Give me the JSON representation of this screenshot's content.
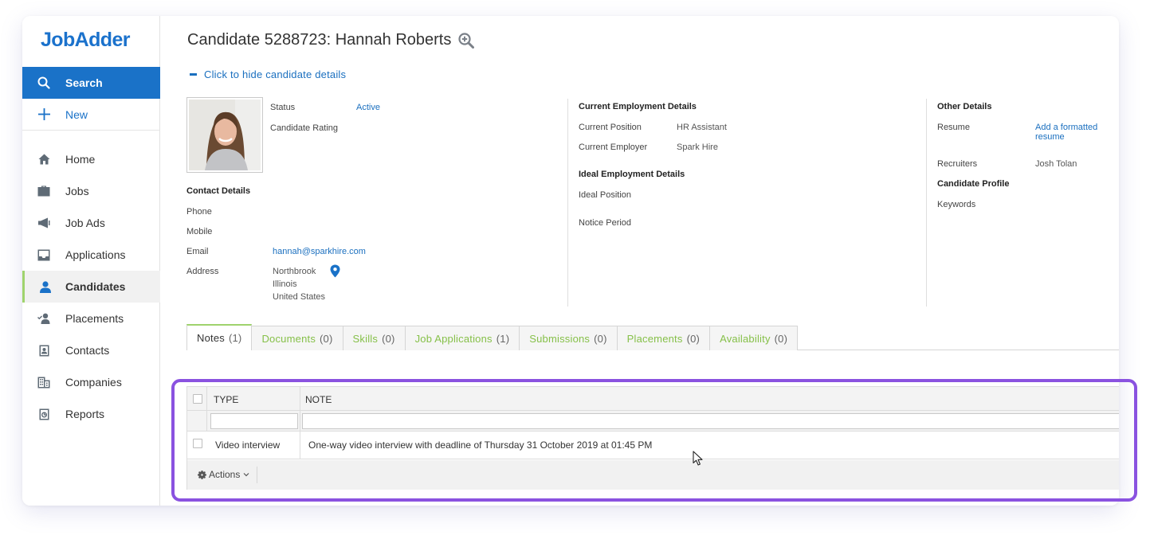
{
  "app": {
    "logo": "JobAdder"
  },
  "sidebar": {
    "search": {
      "label": "Search",
      "icon": "search-icon"
    },
    "new": {
      "label": "New",
      "icon": "plus-icon"
    },
    "items": [
      {
        "label": "Home",
        "icon": "home-icon"
      },
      {
        "label": "Jobs",
        "icon": "briefcase-icon"
      },
      {
        "label": "Job Ads",
        "icon": "megaphone-icon"
      },
      {
        "label": "Applications",
        "icon": "inbox-icon"
      },
      {
        "label": "Candidates",
        "icon": "person-icon",
        "active": true
      },
      {
        "label": "Placements",
        "icon": "placement-icon"
      },
      {
        "label": "Contacts",
        "icon": "contact-card-icon"
      },
      {
        "label": "Companies",
        "icon": "building-icon"
      },
      {
        "label": "Reports",
        "icon": "report-icon"
      }
    ],
    "accent_color": "#1a72c8",
    "active_marker_color": "#9fd36d"
  },
  "page": {
    "title": "Candidate 5288723: Hannah Roberts",
    "toggle_details": "Click to hide candidate details"
  },
  "summary": {
    "status_label": "Status",
    "status_value": "Active",
    "rating_label": "Candidate Rating"
  },
  "contact": {
    "heading": "Contact Details",
    "phone_label": "Phone",
    "mobile_label": "Mobile",
    "email_label": "Email",
    "email_value": "hannah@sparkhire.com",
    "address_label": "Address",
    "address_lines": [
      "Northbrook",
      "Illinois",
      "United States"
    ]
  },
  "employment": {
    "current_heading": "Current Employment Details",
    "position_label": "Current Position",
    "position_value": "HR Assistant",
    "employer_label": "Current Employer",
    "employer_value": "Spark Hire",
    "ideal_heading": "Ideal Employment Details",
    "ideal_position_label": "Ideal Position",
    "notice_label": "Notice Period"
  },
  "other": {
    "heading": "Other Details",
    "resume_label": "Resume",
    "resume_link": "Add a formatted resume",
    "recruiters_label": "Recruiters",
    "recruiters_value": "Josh Tolan",
    "profile_label": "Candidate Profile",
    "keywords_label": "Keywords"
  },
  "tabs": [
    {
      "label": "Notes",
      "count": "(1)",
      "active": true
    },
    {
      "label": "Documents",
      "count": "(0)"
    },
    {
      "label": "Skills",
      "count": "(0)"
    },
    {
      "label": "Job Applications",
      "count": "(1)"
    },
    {
      "label": "Submissions",
      "count": "(0)"
    },
    {
      "label": "Placements",
      "count": "(0)"
    },
    {
      "label": "Availability",
      "count": "(0)"
    }
  ],
  "notes_grid": {
    "columns": [
      "TYPE",
      "NOTE"
    ],
    "rows": [
      {
        "type": "Video interview",
        "note": "One-way video interview with deadline of Thursday 31 October 2019 at 01:45 PM"
      }
    ],
    "actions_label": "Actions"
  },
  "highlight_color": "#8a52e0"
}
